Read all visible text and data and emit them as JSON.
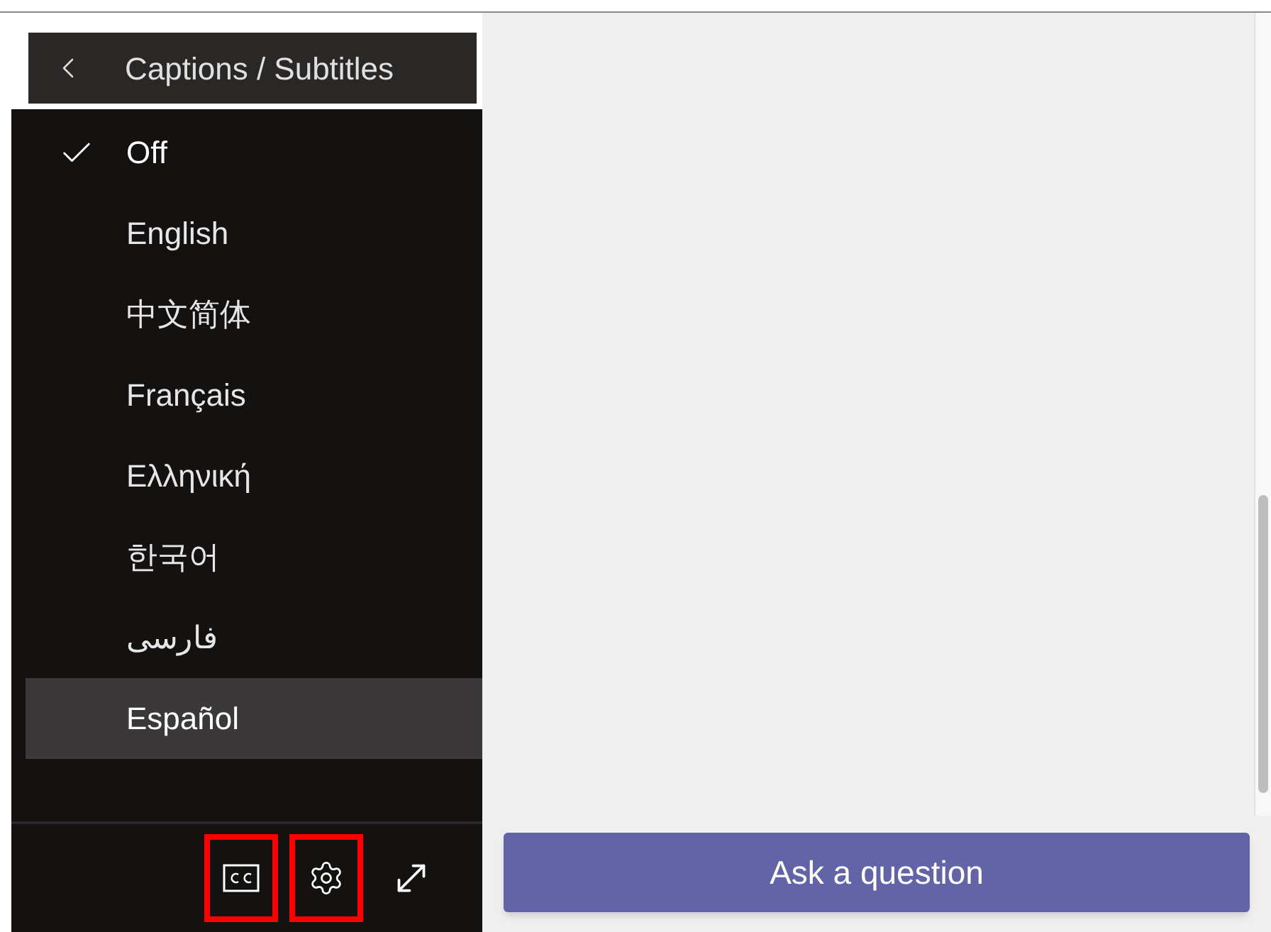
{
  "menu": {
    "title": "Captions / Subtitles",
    "items": [
      {
        "label": "Off",
        "selected": true,
        "hovered": false
      },
      {
        "label": "English",
        "selected": false,
        "hovered": false
      },
      {
        "label": "中文简体",
        "selected": false,
        "hovered": false
      },
      {
        "label": "Français",
        "selected": false,
        "hovered": false
      },
      {
        "label": "Ελληνική",
        "selected": false,
        "hovered": false
      },
      {
        "label": "한국어",
        "selected": false,
        "hovered": false
      },
      {
        "label": "فارسی",
        "selected": false,
        "hovered": false
      },
      {
        "label": "Español",
        "selected": false,
        "hovered": true
      }
    ]
  },
  "controls": [
    {
      "kind": "captions",
      "highlighted": true
    },
    {
      "kind": "settings",
      "highlighted": true
    },
    {
      "kind": "fullscreen",
      "highlighted": false
    }
  ],
  "ask_button": "Ask a question"
}
